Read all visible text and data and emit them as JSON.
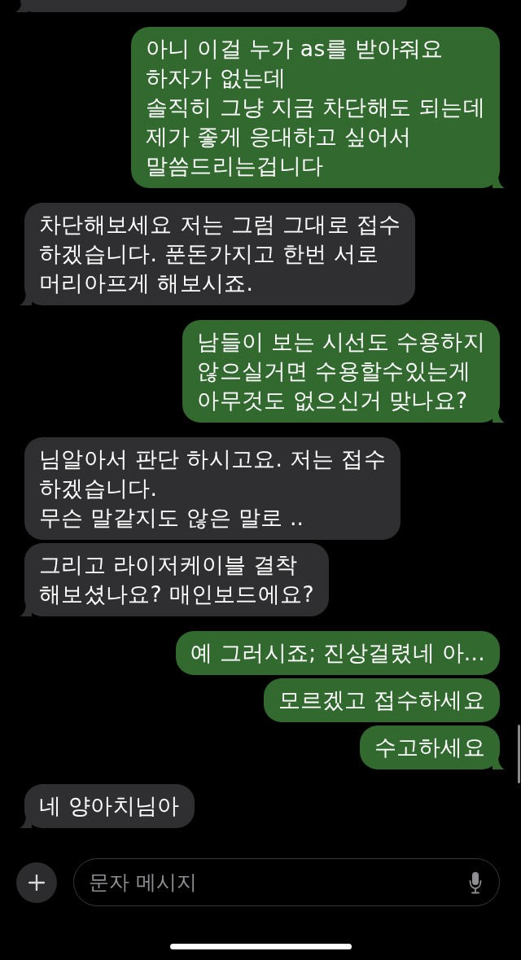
{
  "conversation": {
    "messages": [
      {
        "kind": "received",
        "clipped": true
      },
      {
        "kind": "sent",
        "text": "아니 이걸 누가 as를 받아줘요\n하자가 없는데\n솔직히 그냥 지금 차단해도 되는데\n제가 좋게 응대하고 싶어서\n말씀드리는겁니다"
      },
      {
        "kind": "received",
        "text": "차단해보세요 저는 그럼 그대로 접수\n하겠습니다. 푼돈가지고 한번 서로\n머리아프게 해보시죠."
      },
      {
        "kind": "sent",
        "text": "남들이 보는 시선도 수용하지\n않으실거면 수용할수있는게\n아무것도 없으신거 맞나요?"
      },
      {
        "kind": "received",
        "text": "님알아서 판단 하시고요. 저는 접수\n하겠습니다.\n무슨 말같지도 않은 말로 .."
      },
      {
        "kind": "received",
        "text": "그리고 라이저케이블 결착\n해보셨나요? 매인보드에요?"
      },
      {
        "kind": "sent",
        "text": "예 그러시죠; 진상걸렸네 아..."
      },
      {
        "kind": "sent",
        "text": "모르겠고 접수하세요"
      },
      {
        "kind": "sent",
        "text": "수고하세요"
      },
      {
        "kind": "received",
        "text": "네 양아치님아"
      }
    ]
  },
  "composer": {
    "placeholder": "문자 메시지"
  }
}
